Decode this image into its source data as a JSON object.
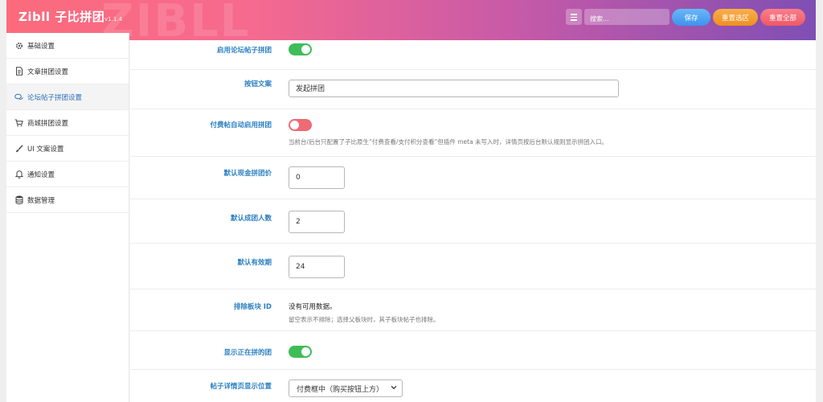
{
  "header": {
    "title": "Zibll 子比拼团",
    "version": "v1.1.4",
    "watermark": "ZIBLL",
    "search_placeholder": "搜索...",
    "save_label": "保存",
    "reset_section_label": "重置选区",
    "reset_all_label": "重置全部",
    "colors": {
      "save": "#3d93ee",
      "reset_section": "#f08f20",
      "reset_all": "#ee5867"
    }
  },
  "sidebar": {
    "items": [
      {
        "label": "基础设置",
        "icon": "gear-icon"
      },
      {
        "label": "文章拼团设置",
        "icon": "document-icon"
      },
      {
        "label": "论坛帖子拼团设置",
        "icon": "comments-icon"
      },
      {
        "label": "商城拼团设置",
        "icon": "cart-icon"
      },
      {
        "label": "UI 文案设置",
        "icon": "brush-icon"
      },
      {
        "label": "通知设置",
        "icon": "bell-icon"
      },
      {
        "label": "数据管理",
        "icon": "database-icon"
      }
    ],
    "active_index": 2
  },
  "form": {
    "enable_forum": {
      "label": "启用论坛帖子拼团",
      "value": true
    },
    "button_text": {
      "label": "按钮文案",
      "value": "发起拼团"
    },
    "paid_auto": {
      "label": "付费帖自动启用拼团",
      "value": false,
      "desc": "当前台/后台只配置了子比原生“付费查看/支付积分查看”但插件 meta 未写入时，详情页按后台默认规则显示拼团入口。"
    },
    "default_price": {
      "label": "默认现金拼团价",
      "value": "0"
    },
    "default_members": {
      "label": "默认成团人数",
      "value": "2"
    },
    "default_validity": {
      "label": "默认有效期",
      "value": "24"
    },
    "exclude_board": {
      "label": "排除板块 ID",
      "value": "没有可用数据。",
      "desc": "留空表示不排除；选择父板块时，其子板块帖子也排除。"
    },
    "show_ongoing": {
      "label": "显示正在拼的团",
      "value": true
    },
    "display_position": {
      "label": "帖子详情页显示位置",
      "value": "付费框中（购买按钮上方）"
    }
  },
  "colors": {
    "toggle_on": "#3ebd59",
    "toggle_off": "#ee6a74",
    "label": "#2a7fc2"
  }
}
